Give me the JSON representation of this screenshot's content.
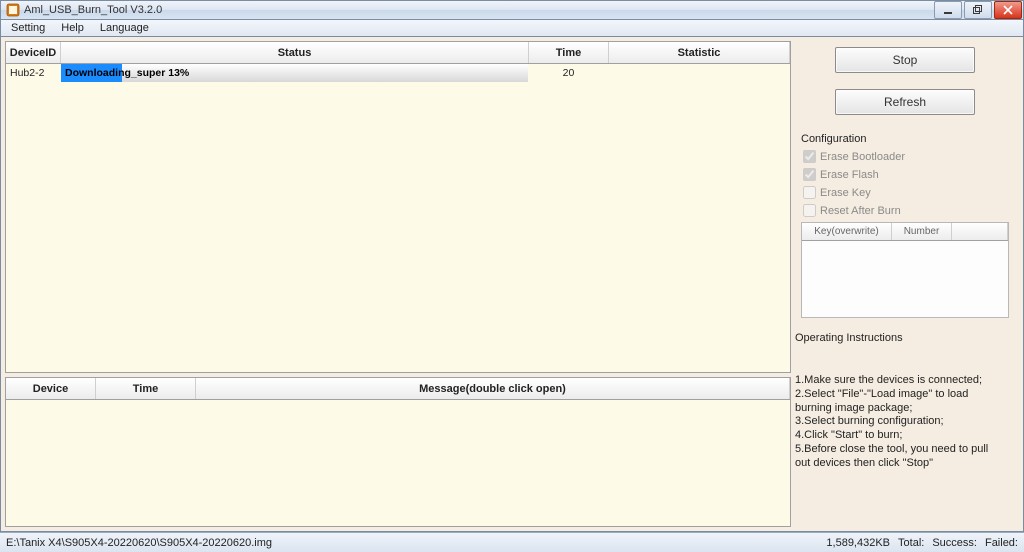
{
  "window": {
    "title": "Aml_USB_Burn_Tool V3.2.0"
  },
  "menu": {
    "setting": "Setting",
    "help": "Help",
    "language": "Language"
  },
  "top_table": {
    "columns": {
      "device_id": "DeviceID",
      "status": "Status",
      "time": "Time",
      "statistic": "Statistic"
    },
    "row": {
      "device_id": "Hub2-2",
      "status_label": "Downloading_super 13%",
      "progress_percent": "13",
      "time": "20",
      "statistic": ""
    }
  },
  "bottom_table": {
    "columns": {
      "device": "Device",
      "time": "Time",
      "message": "Message(double click open)"
    }
  },
  "buttons": {
    "stop": "Stop",
    "refresh": "Refresh"
  },
  "config": {
    "title": "Configuration",
    "erase_bootloader": "Erase Bootloader",
    "erase_flash": "Erase Flash",
    "erase_key": "Erase Key",
    "reset_after_burn": "Reset After Burn",
    "key_table": {
      "key_col": "Key(overwrite)",
      "number_col": "Number"
    }
  },
  "instructions": {
    "title": "Operating Instructions",
    "line1": "1.Make sure the devices is connected;",
    "line2": "2.Select \"File\"-\"Load image\" to load burning image package;",
    "line3": "3.Select burning configuration;",
    "line4": "4.Click \"Start\" to burn;",
    "line5": "5.Before close the tool, you need to pull out devices then click \"Stop\""
  },
  "statusbar": {
    "path": "E:\\Tanix X4\\S905X4-20220620\\S905X4-20220620.img",
    "size": "1,589,432KB",
    "total_label": "Total:",
    "success_label": "Success:",
    "failed_label": "Failed:"
  }
}
